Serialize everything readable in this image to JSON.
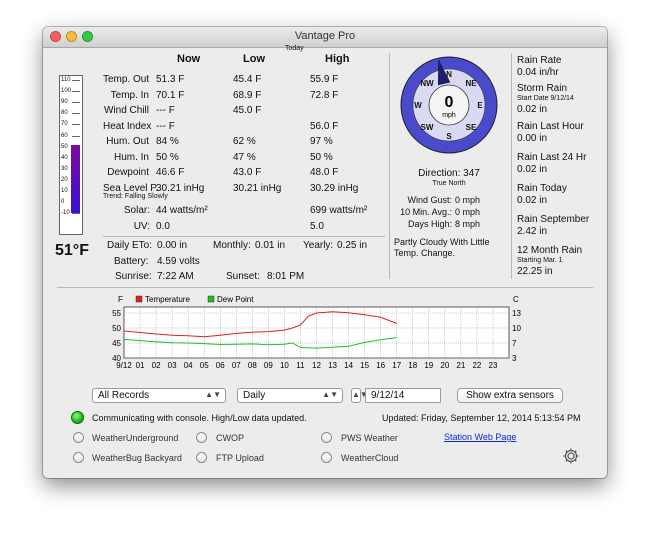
{
  "window": {
    "title": "Vantage Pro"
  },
  "thermometer": {
    "reading": "51°F",
    "value_f": 51,
    "scale": [
      "110",
      "100",
      "90",
      "80",
      "70",
      "60",
      "50",
      "40",
      "30",
      "20",
      "10",
      "0",
      "-10"
    ]
  },
  "table": {
    "today_label": "Today",
    "headers": {
      "now": "Now",
      "low": "Low",
      "high": "High"
    },
    "rows": [
      {
        "label": "Temp. Out",
        "now": "51.3 F",
        "low": "45.4 F",
        "high": "55.9 F"
      },
      {
        "label": "Temp. In",
        "now": "70.1 F",
        "low": "68.9 F",
        "high": "72.8 F"
      },
      {
        "label": "Wind Chill",
        "now": "--- F",
        "low": "45.0 F",
        "high": ""
      },
      {
        "label": "Heat Index",
        "now": "--- F",
        "low": "",
        "high": "56.0 F"
      },
      {
        "label": "Hum. Out",
        "now": "84 %",
        "low": "62 %",
        "high": "97 %"
      },
      {
        "label": "Hum. In",
        "now": "50 %",
        "low": "47 %",
        "high": "50 %"
      },
      {
        "label": "Dewpoint",
        "now": "46.6 F",
        "low": "43.0 F",
        "high": "48.0 F"
      },
      {
        "label": "Sea Level P.",
        "now": "30.21 inHg",
        "low": "30.21 inHg",
        "high": "30.29 inHg"
      }
    ],
    "trend": "Trend:  Falling  Slowly",
    "solar": {
      "label": "Solar:",
      "now": "44 watts/m²",
      "high": "699 watts/m²"
    },
    "uv": {
      "label": "UV:",
      "now": "0.0",
      "high": "5.0"
    }
  },
  "totals": {
    "daily_eto_label": "Daily ETo:",
    "daily_eto": "0.00 in",
    "monthly_label": "Monthly:",
    "monthly": "0.01 in",
    "yearly_label": "Yearly:",
    "yearly": "0.25 in",
    "battery_label": "Battery:",
    "battery": "4.59 volts",
    "sunrise_label": "Sunrise:",
    "sunrise": "7:22 AM",
    "sunset_label": "Sunset:",
    "sunset": "8:01 PM"
  },
  "compass": {
    "speed": "0",
    "unit": "mph",
    "direction_deg": 347,
    "points": {
      "n": "N",
      "ne": "NE",
      "e": "E",
      "se": "SE",
      "s": "S",
      "sw": "SW",
      "w": "W",
      "nw": "NW"
    },
    "direction_text": "Direction: 347",
    "reference": "True North"
  },
  "wind": {
    "gust_label": "Wind Gust:",
    "gust": "0 mph",
    "avg_label": "10 Min. Avg.:",
    "avg": "0 mph",
    "days_high_label": "Days High:",
    "days_high": "8 mph"
  },
  "forecast": "Partly Cloudy With Little Temp. Change.",
  "rain": {
    "rate_label": "Rain Rate",
    "rate": "0.04 in/hr",
    "storm_label": "Storm Rain",
    "storm_start": "Start Date 9/12/14",
    "storm": "0.02 in",
    "last_hour_label": "Rain Last Hour",
    "last_hour": "0.00 in",
    "last24_label": "Rain Last 24 Hr",
    "last24": "0.02 in",
    "today_label": "Rain Today",
    "today": "0.02 in",
    "month_label": "Rain September",
    "month": "2.42 in",
    "year_label": "12 Month Rain",
    "year_start": "Starting Mar. 1",
    "year": "22.25 in"
  },
  "chart_data": {
    "type": "line",
    "left_unit": "F",
    "right_unit": "C",
    "x_ticks": [
      "9/12",
      "01",
      "02",
      "03",
      "04",
      "05",
      "06",
      "07",
      "08",
      "09",
      "10",
      "11",
      "12",
      "13",
      "14",
      "15",
      "16",
      "17",
      "18",
      "19",
      "20",
      "21",
      "22",
      "23"
    ],
    "ylim_f": [
      40,
      57
    ],
    "y_ticks_f": [
      "55",
      "50",
      "45",
      "40"
    ],
    "y_ticks_c": [
      "13",
      "10",
      "7",
      "3"
    ],
    "grid": true,
    "legend_position": "top-left",
    "series": [
      {
        "name": "Temperature",
        "color": "#e02020",
        "x": [
          0,
          1,
          2,
          3,
          4,
          5,
          6,
          7,
          8,
          9,
          10,
          10.5,
          11,
          11.5,
          12,
          13,
          14,
          15,
          16,
          17
        ],
        "values": [
          49,
          48.5,
          48,
          47.6,
          47.4,
          47.1,
          47.6,
          48.2,
          48.6,
          48.8,
          49.3,
          50,
          51,
          54,
          55,
          55.4,
          55.1,
          54.4,
          53.6,
          51.5
        ]
      },
      {
        "name": "Dew Point",
        "color": "#20c020",
        "x": [
          0,
          1,
          2,
          3,
          4,
          5,
          6,
          7,
          8,
          9,
          10,
          10.5,
          11,
          12,
          13,
          14,
          15,
          16,
          17
        ],
        "values": [
          46.2,
          45.8,
          45.4,
          45.1,
          45.0,
          44.8,
          44.5,
          44.6,
          44.7,
          44.4,
          44.6,
          45.0,
          43.5,
          43.3,
          43.6,
          43.9,
          45.2,
          46.1,
          46.8
        ]
      }
    ]
  },
  "controls": {
    "records": "All Records",
    "period": "Daily",
    "date": "9/12/14",
    "extra_sensors": "Show extra sensors"
  },
  "status": {
    "message": "Communicating with console. High/Low data updated.",
    "updated": "Updated: Friday, September 12, 2014 5:13:54 PM",
    "link": "Station Web Page"
  },
  "uploads": [
    "WeatherUnderground",
    "CWOP",
    "PWS Weather",
    "WeatherBug Backyard",
    "FTP Upload",
    "WeatherCloud"
  ]
}
